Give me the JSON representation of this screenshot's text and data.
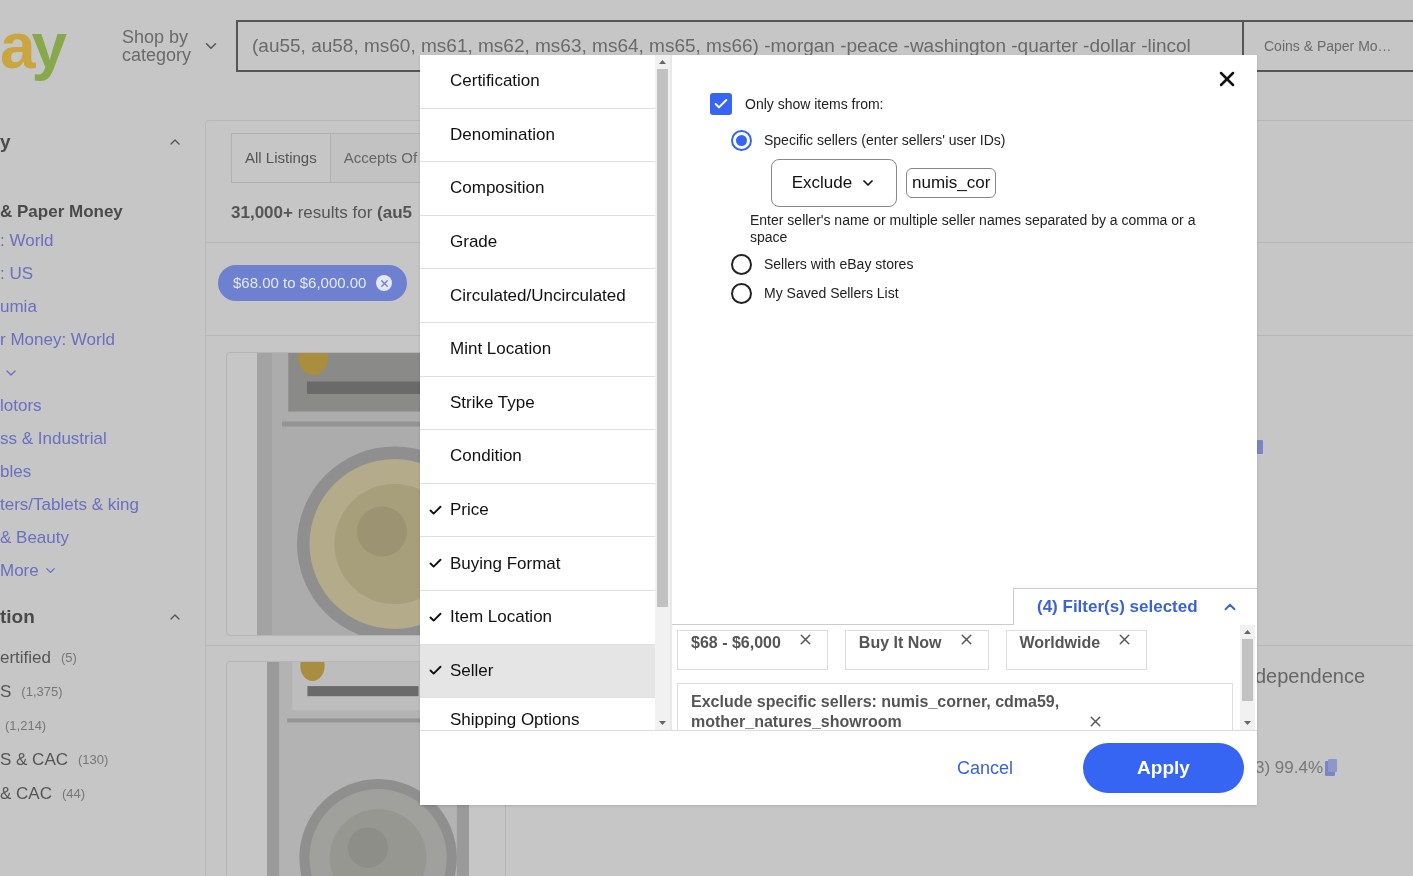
{
  "header": {
    "logo": [
      {
        "text": "a",
        "color": "#c9a640"
      },
      {
        "text": "y",
        "color": "#87a94b"
      }
    ],
    "shop_by_category": "Shop by category",
    "search_value": "(au55, au58, ms60, ms61, ms62, ms63, ms64, ms65, ms66) -morgan -peace -washington -quarter -dollar -lincol",
    "category_select": "Coins & Paper Mo…"
  },
  "sidebar": [
    {
      "kind": "header",
      "label": "y"
    },
    {
      "kind": "title",
      "label": "& Paper Money"
    },
    {
      "kind": "link",
      "label": ": World"
    },
    {
      "kind": "link",
      "label": ": US"
    },
    {
      "kind": "link",
      "label": "umia"
    },
    {
      "kind": "link",
      "label": "r Money: World"
    },
    {
      "kind": "expand"
    },
    {
      "kind": "link",
      "label": "lotors"
    },
    {
      "kind": "link",
      "label": "ss & Industrial"
    },
    {
      "kind": "link",
      "label": "bles"
    },
    {
      "kind": "link",
      "label": "ters/Tablets & king"
    },
    {
      "kind": "link",
      "label": "& Beauty"
    },
    {
      "kind": "more",
      "label": "More"
    },
    {
      "kind": "header",
      "label": "tion"
    },
    {
      "kind": "option",
      "label": "ertified",
      "count": "(5)"
    },
    {
      "kind": "option",
      "label": "S",
      "count": "(1,375)"
    },
    {
      "kind": "option",
      "count": "(1,214)"
    },
    {
      "kind": "option",
      "label": "S & CAC",
      "count": "(130)"
    },
    {
      "kind": "option",
      "label": "& CAC",
      "count": "(44)"
    }
  ],
  "results": {
    "tabs": [
      {
        "label": "All Listings",
        "selected": true
      },
      {
        "label": "Accepts Of",
        "selected": false
      }
    ],
    "summary": "**31,000+** results for **(au5**",
    "price_chip": "$68.00 to $6,000.00"
  },
  "listings": [
    {
      "kind": "picture"
    },
    {
      "kind": "picture",
      "title": "dependence",
      "feedback": "3) 99.4%"
    }
  ],
  "modal": {
    "categories": [
      {
        "label": "Certification",
        "checked": false,
        "selected": false
      },
      {
        "label": "Denomination",
        "checked": false,
        "selected": false
      },
      {
        "label": "Composition",
        "checked": false,
        "selected": false
      },
      {
        "label": "Grade",
        "checked": false,
        "selected": false
      },
      {
        "label": "Circulated/Uncirculated",
        "checked": false,
        "selected": false
      },
      {
        "label": "Mint Location",
        "checked": false,
        "selected": false
      },
      {
        "label": "Strike Type",
        "checked": false,
        "selected": false
      },
      {
        "label": "Condition",
        "checked": false,
        "selected": false
      },
      {
        "label": "Price",
        "checked": true,
        "selected": false
      },
      {
        "label": "Buying Format",
        "checked": true,
        "selected": false
      },
      {
        "label": "Item Location",
        "checked": true,
        "selected": false
      },
      {
        "label": "Seller",
        "checked": true,
        "selected": true
      },
      {
        "label": "Shipping Options",
        "checked": false,
        "selected": false
      }
    ],
    "only_show": {
      "label": "Only show items from:",
      "checked": true
    },
    "seller_options": [
      {
        "kind": "specific",
        "label": "Specific sellers (enter sellers' user IDs)",
        "selected": true,
        "mode": "Exclude",
        "sellers": "numis_cor",
        "help": "Enter seller's name or multiple seller names separated by a comma or a space"
      },
      {
        "kind": "plain",
        "label": "Sellers with eBay stores",
        "selected": false
      },
      {
        "kind": "plain",
        "label": "My Saved Sellers List",
        "selected": false
      }
    ],
    "summary": {
      "title": "(4) Filter(s) selected",
      "expanded": true,
      "chips": [
        {
          "label": "$68 - $6,000"
        },
        {
          "label": "Buy It Now"
        },
        {
          "label": "Worldwide"
        },
        {
          "label": "Exclude specific sellers: numis_corner, cdma59, mother_natures_showroom"
        }
      ]
    },
    "cancel": "Cancel",
    "apply": "Apply"
  }
}
